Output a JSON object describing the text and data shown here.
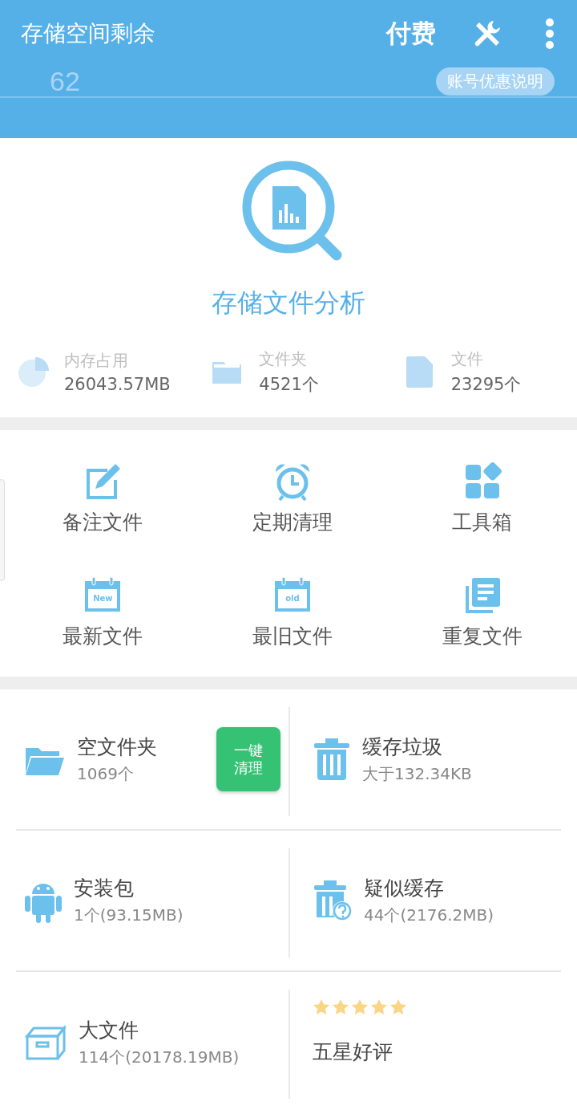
{
  "header": {
    "title": "存储空间剩余",
    "pay": "付费",
    "remaining": "62",
    "account_button": "账号优惠说明"
  },
  "analysis": {
    "title": "存储文件分析",
    "stats": [
      {
        "kind": "memory",
        "label": "内存占用",
        "value": "26043.57MB"
      },
      {
        "kind": "folder",
        "label": "文件夹",
        "value": "4521个"
      },
      {
        "kind": "file",
        "label": "文件",
        "value": "23295个"
      }
    ]
  },
  "tools": [
    {
      "kind": "note",
      "label": "备注文件"
    },
    {
      "kind": "clock",
      "label": "定期清理"
    },
    {
      "kind": "toolbox",
      "label": "工具箱"
    },
    {
      "kind": "new",
      "label": "最新文件",
      "badge": "New"
    },
    {
      "kind": "old",
      "label": "最旧文件",
      "badge": "old"
    },
    {
      "kind": "duplicate",
      "label": "重复文件"
    }
  ],
  "cards": [
    {
      "kind": "folder",
      "title": "空文件夹",
      "detail": "1069个",
      "action": "一键清理"
    },
    {
      "kind": "trash",
      "title": "缓存垃圾",
      "detail": "大于132.34KB"
    },
    {
      "kind": "android",
      "title": "安装包",
      "detail": "1个(93.15MB)"
    },
    {
      "kind": "suspect",
      "title": "疑似缓存",
      "detail": "44个(2176.2MB)"
    },
    {
      "kind": "box",
      "title": "大文件",
      "detail": "114个(20178.19MB)"
    },
    {
      "kind": "rating",
      "title": "五星好评",
      "stars": 5
    }
  ]
}
